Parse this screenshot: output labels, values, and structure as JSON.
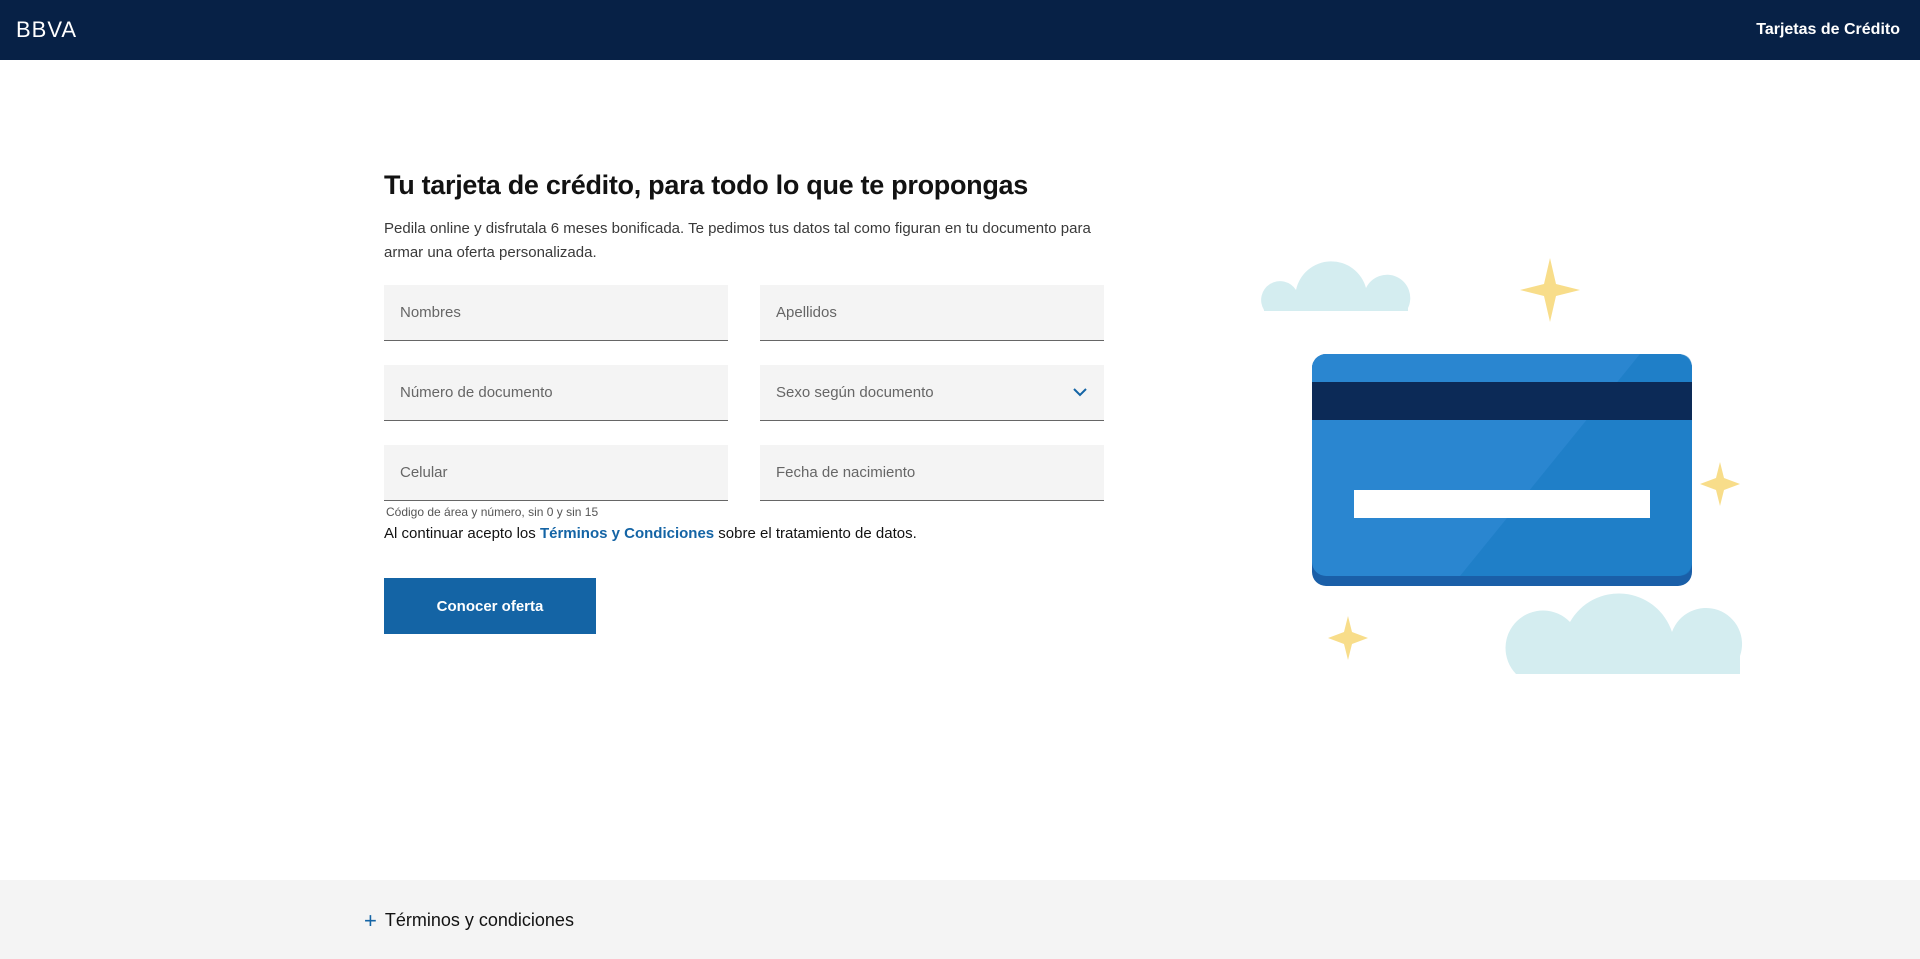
{
  "header": {
    "logo": "BBVA",
    "nav_link": "Tarjetas de Crédito"
  },
  "main": {
    "title": "Tu tarjeta de crédito, para todo lo que te propongas",
    "subtitle": "Pedila online y disfrutala 6 meses bonificada. Te pedimos tus datos tal como figuran en tu documento para armar una oferta personalizada.",
    "fields": {
      "nombres_placeholder": "Nombres",
      "apellidos_placeholder": "Apellidos",
      "documento_placeholder": "Número de documento",
      "sexo_label": "Sexo según documento",
      "celular_placeholder": "Celular",
      "celular_helper": "Código de área y número, sin 0 y sin 15",
      "fecha_placeholder": "Fecha de nacimiento"
    },
    "terms": {
      "prefix": "Al continuar acepto los ",
      "link": "Términos y Condiciones",
      "suffix": " sobre el tratamiento de datos."
    },
    "cta_label": "Conocer oferta"
  },
  "footer": {
    "accordion_icon": "+",
    "accordion_label": "Términos y condiciones"
  },
  "colors": {
    "header_bg": "#072146",
    "primary": "#1464a5",
    "card_blue": "#2a86d0",
    "cloud": "#d4edf0",
    "star": "#f8dd8a"
  }
}
